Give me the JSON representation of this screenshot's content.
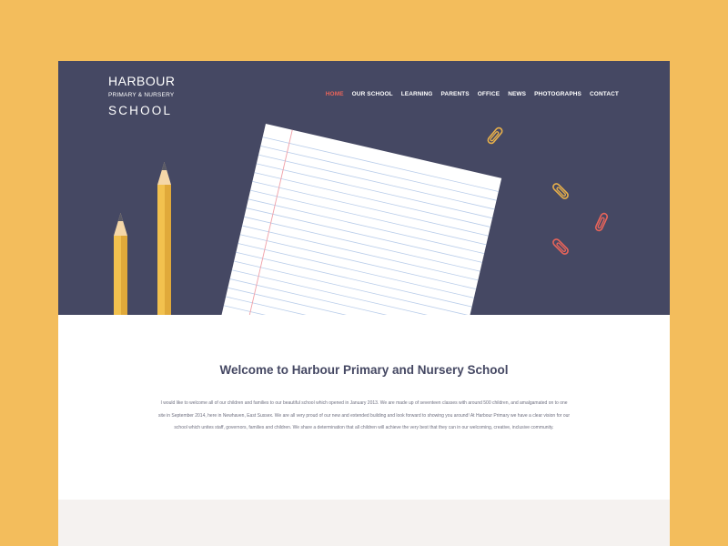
{
  "logo": {
    "line1": "HARBOUR",
    "line2": "PRIMARY & NURSERY",
    "line3": "SCHOOL"
  },
  "nav": {
    "items": [
      "HOME",
      "OUR SCHOOL",
      "LEARNING",
      "PARENTS",
      "OFFICE",
      "NEWS",
      "PHOTOGRAPHS",
      "CONTACT"
    ],
    "active": "HOME"
  },
  "welcome": {
    "title": "Welcome to Harbour Primary and Nursery School",
    "body": "I would like to welcome all of our children and families to our beautiful school which opened in January 2013. We are made up of seventeen classes with around 500 children, and amalgamated on to one site in September 2014, here in Newhaven, East Sussex. We are all very proud of our new and extended building and look forward to showing you around!  At Harbour Primary we have a clear vision for our school which unites staff, governors, families and children. We share a determination that all children will achieve the very best that they can in our welcoming, creative, inclusive community."
  },
  "colors": {
    "background": "#f3bd5c",
    "hero": "#454863",
    "accent": "#e8645a",
    "pencil": "#f2c14e",
    "paperclip_gold": "#e8b04a",
    "paperclip_red": "#e8645a",
    "grey_band": "#f5f2f0"
  },
  "icons": {
    "pencil": "pencil-icon",
    "paper": "lined-paper-icon",
    "paperclip": "paperclip-icon"
  }
}
